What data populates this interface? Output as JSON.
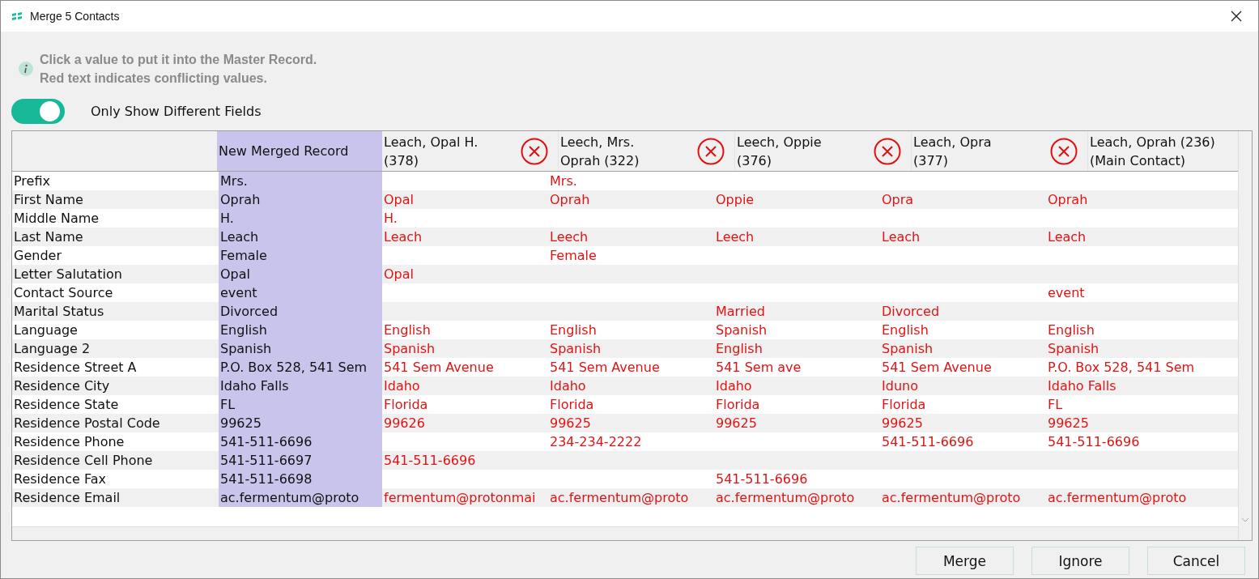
{
  "window": {
    "title": "Merge 5 Contacts"
  },
  "info": [
    "Click a value to put it into the Master Record.",
    "Red text indicates conflicting values."
  ],
  "toggle": {
    "label": "Only Show Different Fields",
    "on": true
  },
  "table": {
    "merged_header": "New Merged Record",
    "contacts": [
      {
        "lines": [
          "Leach, Opal H.",
          "(378)"
        ],
        "removable": true
      },
      {
        "lines": [
          "Leech, Mrs.",
          "Oprah (322)"
        ],
        "removable": true
      },
      {
        "lines": [
          "Leech, Oppie",
          "(376)"
        ],
        "removable": true
      },
      {
        "lines": [
          "Leach, Opra",
          "(377)"
        ],
        "removable": true
      },
      {
        "lines": [
          "Leach, Oprah (236)",
          "(Main Contact)"
        ],
        "removable": false
      }
    ],
    "rows": [
      {
        "field": "Prefix",
        "merged": "Mrs.",
        "contact_2": "Mrs."
      },
      {
        "field": "First Name",
        "merged": "Oprah",
        "contact_1": "Opal",
        "contact_2": "Oprah",
        "contact_3": "Oppie",
        "contact_4": "Opra",
        "contact_5": "Oprah"
      },
      {
        "field": "Middle Name",
        "merged": "H.",
        "contact_1": "H."
      },
      {
        "field": "Last Name",
        "merged": "Leach",
        "contact_1": "Leach",
        "contact_2": "Leech",
        "contact_3": "Leech",
        "contact_4": "Leach",
        "contact_5": "Leach"
      },
      {
        "field": "Gender",
        "merged": "Female",
        "contact_2": "Female"
      },
      {
        "field": "Letter Salutation",
        "merged": "Opal",
        "contact_1": "Opal"
      },
      {
        "field": "Contact Source",
        "merged": "event",
        "contact_5": "event"
      },
      {
        "field": "Marital Status",
        "merged": "Divorced",
        "contact_3": "Married",
        "contact_4": "Divorced"
      },
      {
        "field": "Language",
        "merged": "English",
        "contact_1": "English",
        "contact_2": "English",
        "contact_3": "Spanish",
        "contact_4": "English",
        "contact_5": "English"
      },
      {
        "field": "Language 2",
        "merged": "Spanish",
        "contact_1": "Spanish",
        "contact_2": "Spanish",
        "contact_3": "English",
        "contact_4": "Spanish",
        "contact_5": "Spanish"
      },
      {
        "field": "Residence Street A",
        "merged": "P.O. Box 528, 541 Sem",
        "contact_1": "541 Sem Avenue",
        "contact_2": "541 Sem Avenue",
        "contact_3": "541 Sem ave",
        "contact_4": "541 Sem Avenue",
        "contact_5": "P.O. Box 528, 541 Sem"
      },
      {
        "field": "Residence City",
        "merged": "Idaho Falls",
        "contact_1": "Idaho",
        "contact_2": "Idaho",
        "contact_3": "Idaho",
        "contact_4": "Iduno",
        "contact_5": "Idaho Falls"
      },
      {
        "field": "Residence State",
        "merged": "FL",
        "contact_1": "Florida",
        "contact_2": "Florida",
        "contact_3": "Florida",
        "contact_4": "Florida",
        "contact_5": "FL"
      },
      {
        "field": "Residence Postal Code",
        "merged": "99625",
        "contact_1": "99626",
        "contact_2": "99625",
        "contact_3": "99625",
        "contact_4": "99625",
        "contact_5": "99625"
      },
      {
        "field": "Residence Phone",
        "merged": "541-511-6696",
        "contact_2": "234-234-2222",
        "contact_4": "541-511-6696",
        "contact_5": "541-511-6696"
      },
      {
        "field": "Residence Cell Phone",
        "merged": "541-511-6697",
        "contact_1": "541-511-6696"
      },
      {
        "field": "Residence Fax",
        "merged": "541-511-6698",
        "contact_3": "541-511-6696"
      },
      {
        "field": "Residence Email",
        "merged": "ac.fermentum@proto",
        "contact_1": "fermentum@protonmai",
        "contact_2": "ac.fermentum@proto",
        "contact_3": "ac.fermentum@proto",
        "contact_4": "ac.fermentum@proto",
        "contact_5": "ac.fermentum@proto"
      }
    ]
  },
  "buttons": [
    "Merge",
    "Ignore",
    "Cancel"
  ]
}
